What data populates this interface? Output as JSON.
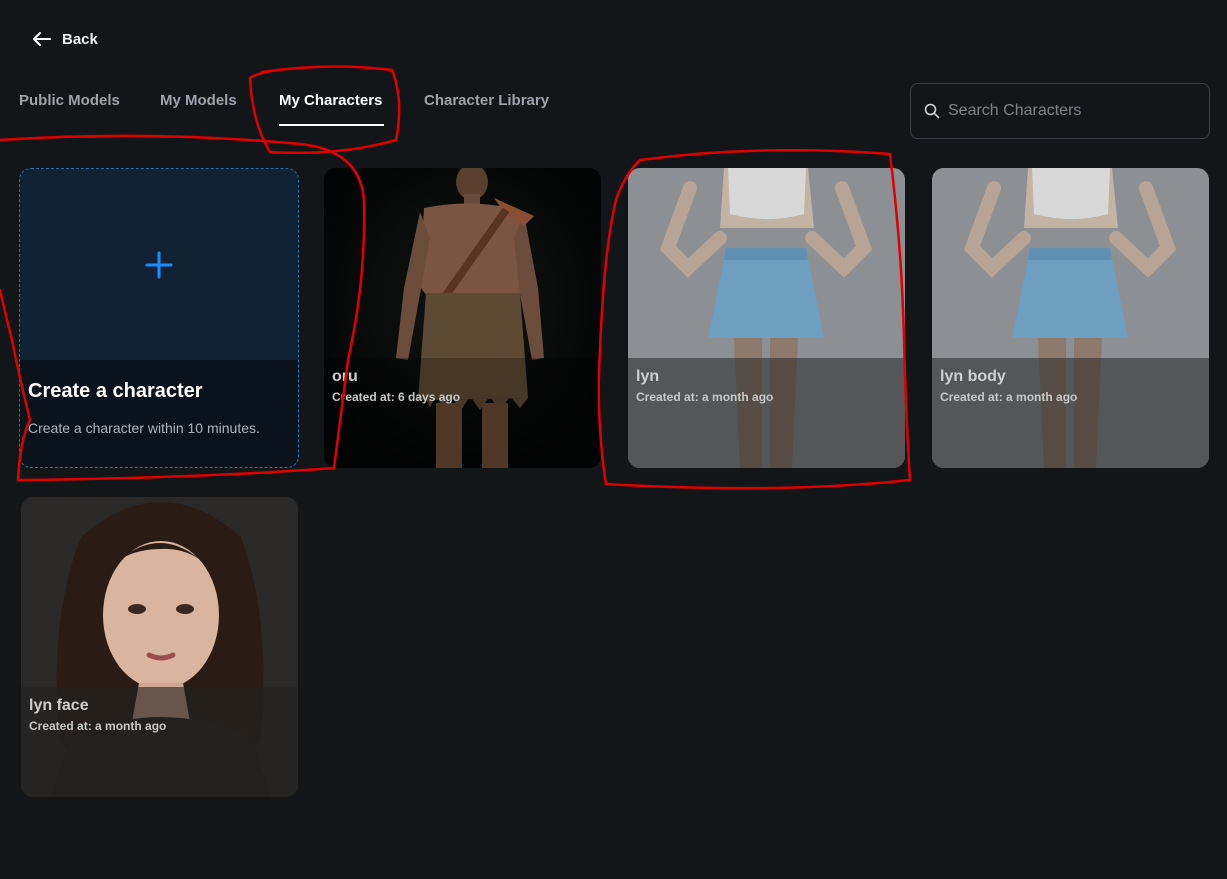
{
  "nav": {
    "back_label": "Back"
  },
  "tabs": [
    {
      "label": "Public Models",
      "active": false
    },
    {
      "label": "My Models",
      "active": false
    },
    {
      "label": "My Characters",
      "active": true
    },
    {
      "label": "Character Library",
      "active": false
    }
  ],
  "search": {
    "placeholder": "Search Characters",
    "value": ""
  },
  "create_card": {
    "icon": "plus-icon",
    "title": "Create a character",
    "description": "Create a character within 10 minutes."
  },
  "characters": [
    {
      "name": "oru",
      "created": "Created at: 6 days ago"
    },
    {
      "name": "lyn",
      "created": "Created at: a month ago"
    },
    {
      "name": "lyn body",
      "created": "Created at: a month ago"
    },
    {
      "name": "lyn face",
      "created": "Created at: a month ago"
    }
  ],
  "colors": {
    "background": "#131619",
    "accent": "#1e8cff",
    "annotation": "#e00000"
  }
}
